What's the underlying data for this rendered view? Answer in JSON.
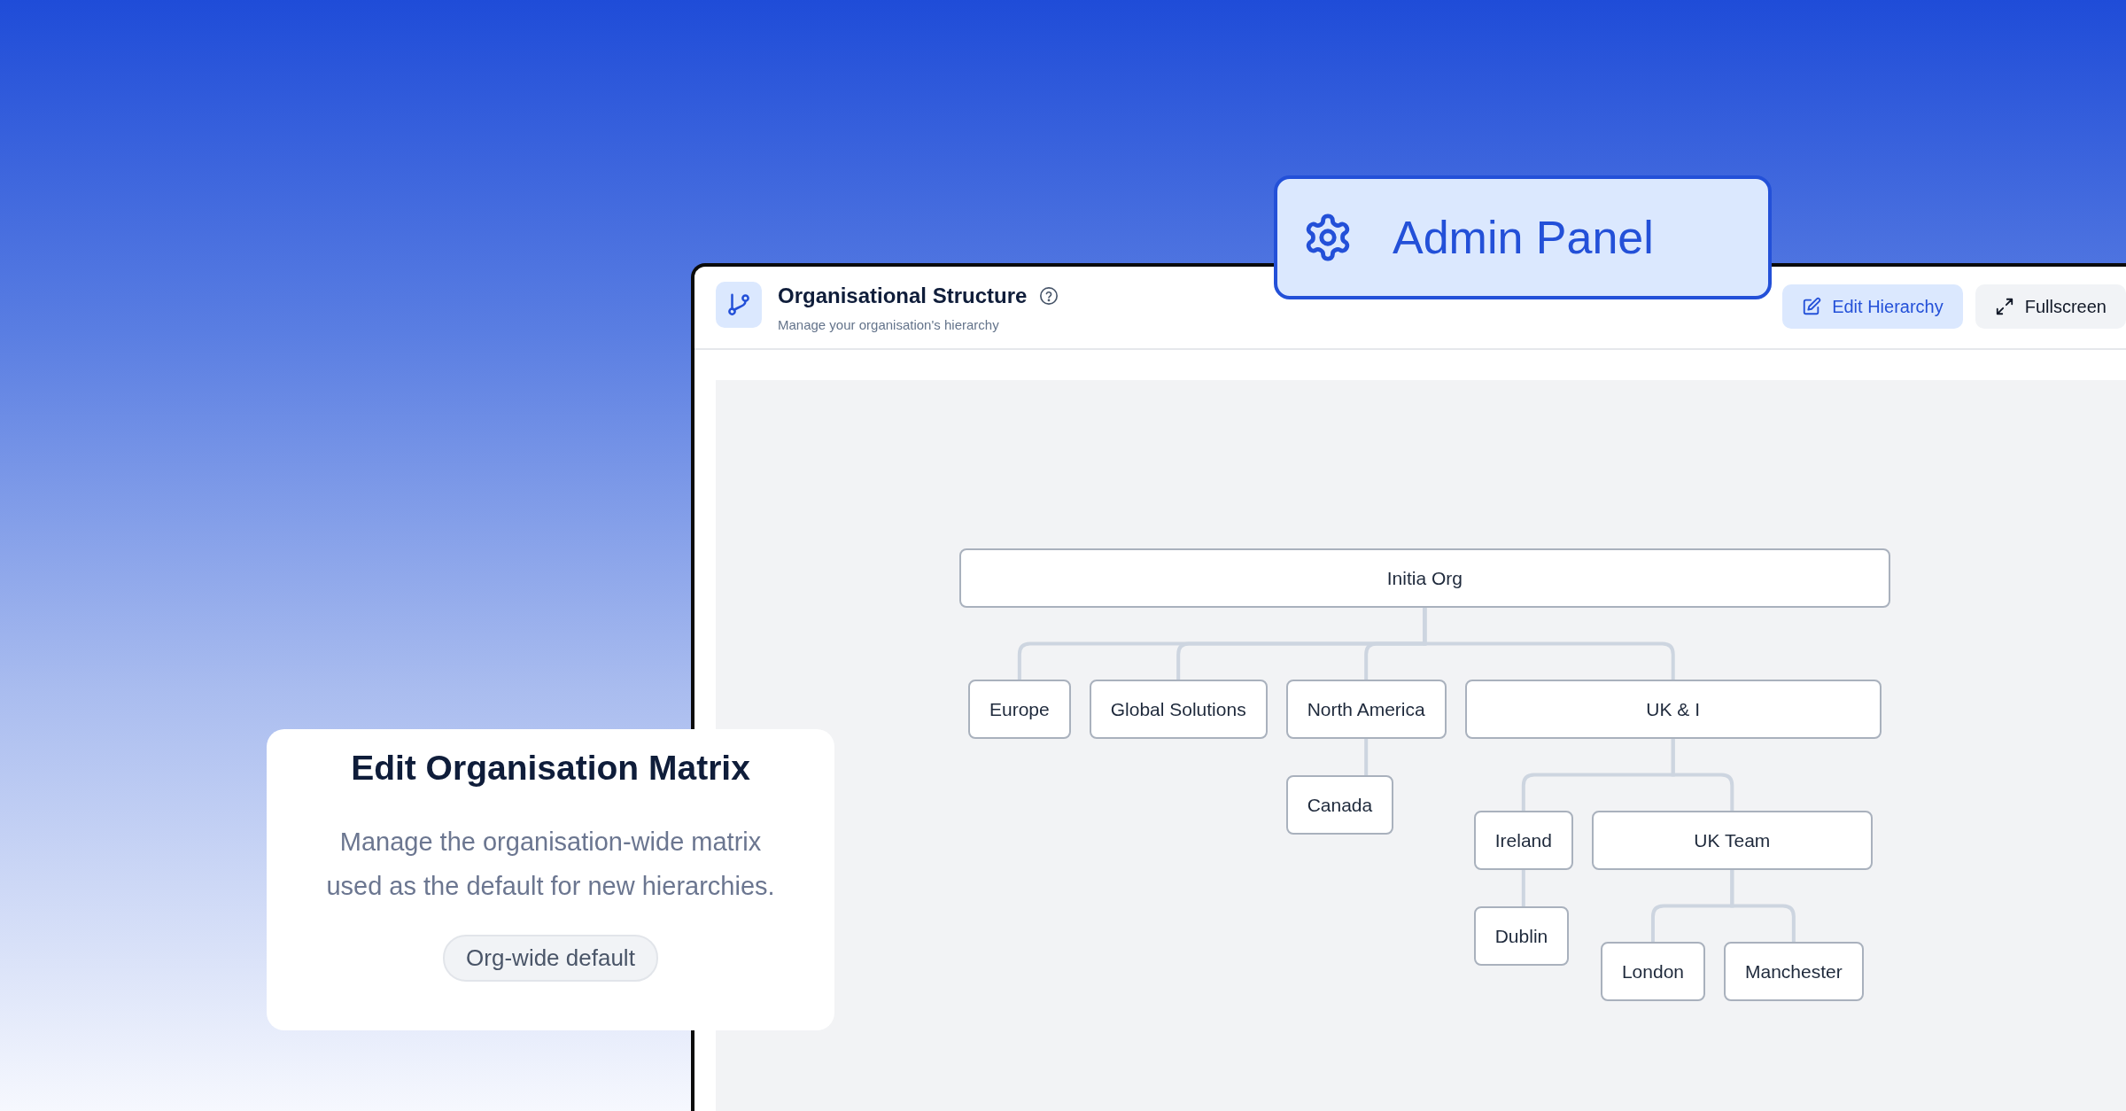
{
  "window": {
    "title": "Organisational Structure",
    "subtitle": "Manage your organisation's hierarchy",
    "actions": [
      {
        "label": "Edit Hierarchy",
        "kind": "primary"
      },
      {
        "label": "Fullscreen",
        "kind": "secondary"
      }
    ]
  },
  "admin_badge": {
    "label": "Admin Panel"
  },
  "org_chart": {
    "root": {
      "name": "Initia Org",
      "children": [
        {
          "name": "Europe"
        },
        {
          "name": "Global Solutions"
        },
        {
          "name": "North America",
          "children": [
            {
              "name": "Canada"
            }
          ]
        },
        {
          "name": "UK & I",
          "children": [
            {
              "name": "Ireland",
              "children": [
                {
                  "name": "Dublin"
                }
              ]
            },
            {
              "name": "UK Team",
              "children": [
                {
                  "name": "London"
                },
                {
                  "name": "Manchester"
                }
              ]
            }
          ]
        }
      ]
    }
  },
  "info_card": {
    "title": "Edit Organisation Matrix",
    "description": "Manage the organisation-wide matrix used as the default for new hierarchies.",
    "tag": "Org-wide default"
  }
}
